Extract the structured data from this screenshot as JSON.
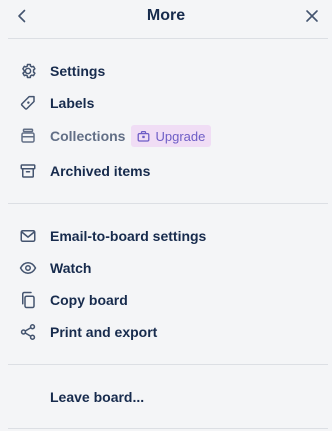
{
  "header": {
    "title": "More",
    "back_icon": "chevron-left-icon",
    "close_icon": "close-icon"
  },
  "menu": {
    "group1": [
      {
        "id": "settings",
        "label": "Settings",
        "icon": "gear-icon"
      },
      {
        "id": "labels",
        "label": "Labels",
        "icon": "tag-icon"
      },
      {
        "id": "collections",
        "label": "Collections",
        "icon": "collections-icon",
        "disabled": true,
        "badge": {
          "label": "Upgrade",
          "icon": "briefcase-icon"
        }
      },
      {
        "id": "archived",
        "label": "Archived items",
        "icon": "archive-icon"
      }
    ],
    "group2": [
      {
        "id": "email",
        "label": "Email-to-board settings",
        "icon": "envelope-icon"
      },
      {
        "id": "watch",
        "label": "Watch",
        "icon": "eye-icon"
      },
      {
        "id": "copy",
        "label": "Copy board",
        "icon": "copy-icon"
      },
      {
        "id": "print",
        "label": "Print and export",
        "icon": "share-icon"
      }
    ],
    "leave": {
      "label": "Leave board..."
    }
  },
  "colors": {
    "background": "#f4f5f7",
    "text": "#172b4d",
    "muted_text": "#626f86",
    "badge_bg": "#f0ddf5",
    "badge_text": "#6e5dc6"
  }
}
